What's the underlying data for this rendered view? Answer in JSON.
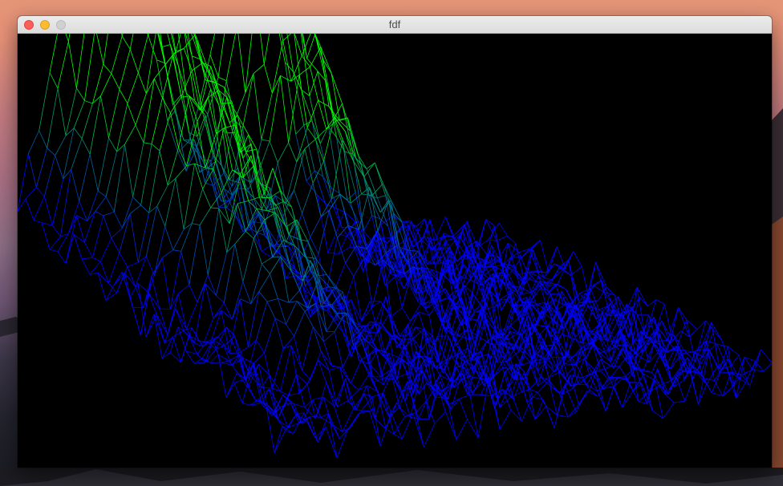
{
  "window": {
    "title": "fdf",
    "buttons": {
      "close": "close-button",
      "minimize": "minimize-button",
      "zoom": "zoom-button"
    }
  },
  "render": {
    "background": "#000000",
    "colors": {
      "low": "#0000ff",
      "mid": "#00ff00",
      "high": "#b03a2e"
    }
  },
  "desktop": {
    "wallpaper_colors": [
      "#e59678",
      "#a87084",
      "#3c3648",
      "#1a1a21"
    ]
  }
}
